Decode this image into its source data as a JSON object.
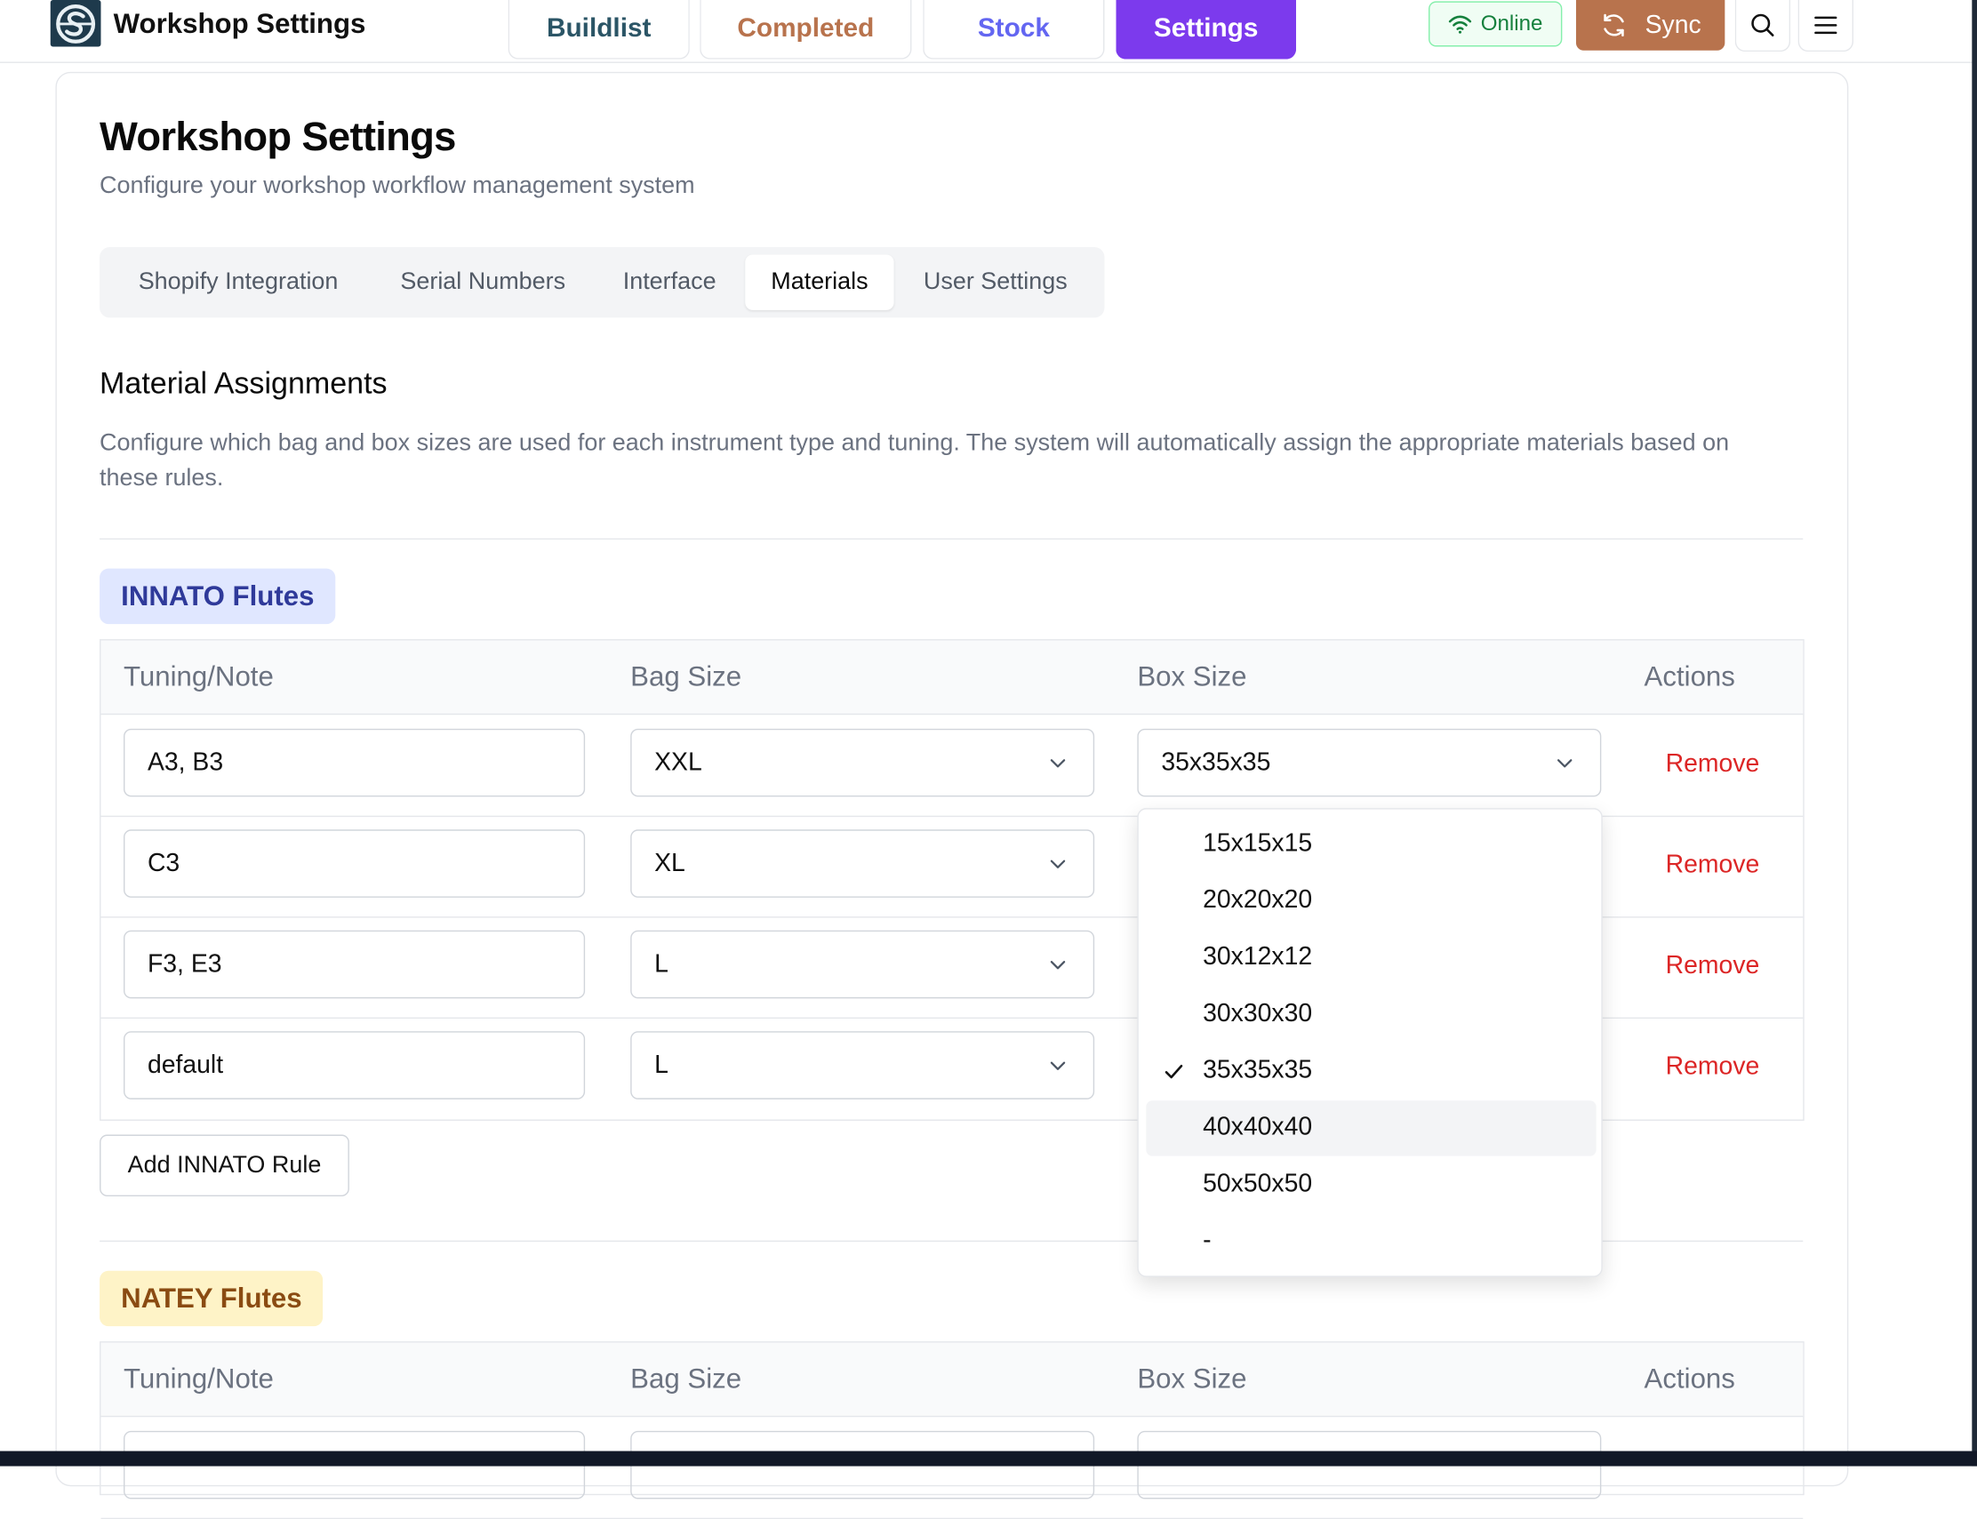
{
  "app": {
    "title": "Workshop Settings"
  },
  "nav": {
    "buildlist": "Buildlist",
    "completed": "Completed",
    "stock": "Stock",
    "settings": "Settings"
  },
  "status": {
    "online": "Online",
    "sync": "Sync"
  },
  "page": {
    "title": "Workshop Settings",
    "subtitle": "Configure your workshop workflow management system"
  },
  "tabs": [
    "Shopify Integration",
    "Serial Numbers",
    "Interface",
    "Materials",
    "User Settings"
  ],
  "section": {
    "title": "Material Assignments",
    "description": "Configure which bag and box sizes are used for each instrument type and tuning. The system will automatically assign the appropriate materials based on these rules."
  },
  "table_headers": {
    "tuning": "Tuning/Note",
    "bag": "Bag Size",
    "box": "Box Size",
    "actions": "Actions"
  },
  "innato": {
    "label": "INNATO Flutes",
    "rows": [
      {
        "tuning": "A3, B3",
        "bag": "XXL",
        "box": "35x35x35",
        "action": "Remove"
      },
      {
        "tuning": "C3",
        "bag": "XL",
        "action": "Remove"
      },
      {
        "tuning": "F3, E3",
        "bag": "L",
        "action": "Remove"
      },
      {
        "tuning": "default",
        "bag": "L",
        "action": "Remove"
      }
    ],
    "add_label": "Add INNATO Rule"
  },
  "natey": {
    "label": "NATEY Flutes"
  },
  "box_dropdown": {
    "options": [
      "15x15x15",
      "20x20x20",
      "30x12x12",
      "30x30x30",
      "35x35x35",
      "40x40x40",
      "50x50x50",
      "-"
    ],
    "selected": "35x35x35",
    "highlighted": "40x40x40"
  },
  "colors": {
    "accent": "#7c3aed",
    "sync": "#b8734d",
    "remove": "#dc2626",
    "online": "#15803d"
  }
}
